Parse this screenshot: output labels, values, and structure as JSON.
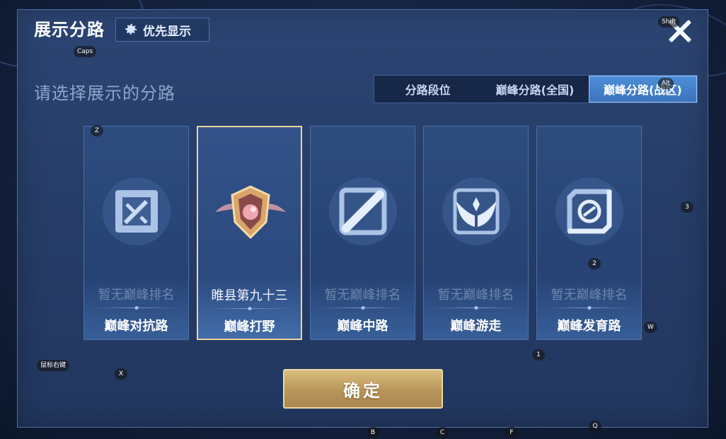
{
  "dialog": {
    "title": "展示分路",
    "priority_button": "优先显示",
    "subtitle": "请选择展示的分路"
  },
  "tabs": [
    {
      "label": "分路段位",
      "active": false
    },
    {
      "label": "巅峰分路(全国)",
      "active": false
    },
    {
      "label": "巅峰分路(战区)",
      "active": true
    }
  ],
  "cards": [
    {
      "lane": "巅峰对抗路",
      "rank": "暂无巅峰排名",
      "icon": "sword-icon",
      "selected": false
    },
    {
      "lane": "巅峰打野",
      "rank": "睢县第九十三",
      "icon": "jungle-badge-icon",
      "selected": true
    },
    {
      "lane": "巅峰中路",
      "rank": "暂无巅峰排名",
      "icon": "mid-lane-icon",
      "selected": false
    },
    {
      "lane": "巅峰游走",
      "rank": "暂无巅峰排名",
      "icon": "wings-icon",
      "selected": false
    },
    {
      "lane": "巅峰发育路",
      "rank": "暂无巅峰排名",
      "icon": "marksman-icon",
      "selected": false
    }
  ],
  "confirm_label": "确定",
  "key_hints": {
    "caps": "Caps",
    "shift": "Shift",
    "alt": "Alt",
    "z": "Z",
    "k3": "3",
    "k2": "2",
    "w": "W",
    "k1": "1",
    "right_click": "鼠标右键",
    "x": "X",
    "b": "B",
    "c": "C",
    "f": "F",
    "q": "Q"
  },
  "colors": {
    "accent_active_tab": "#3a73bd",
    "selected_border": "#f0d39c",
    "confirm_gold": "#b9955a"
  }
}
